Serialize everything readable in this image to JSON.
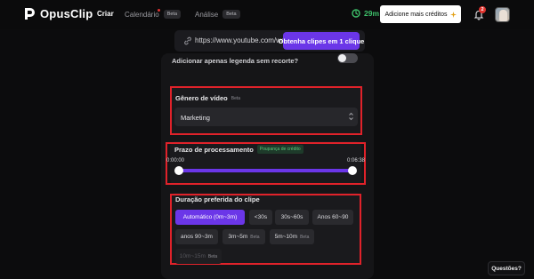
{
  "app": {
    "name": "OpusClip"
  },
  "nav": {
    "criar": "Criar",
    "calendario": "Calendário",
    "calendario_beta": "Beta",
    "analise": "Análise",
    "analise_beta": "Beta"
  },
  "header": {
    "credits": "29m",
    "add_credits": "Adicione mais créditos",
    "notifications_count": "2"
  },
  "url_input": {
    "value": "https://www.youtube.com/wat",
    "button": "Obtenha clipes em 1 clique"
  },
  "subtitle_option": {
    "label": "Adicionar apenas legenda sem recorte?",
    "enabled": false
  },
  "genre": {
    "title": "Gênero de vídeo",
    "beta": "Beta",
    "selected": "Marketing"
  },
  "timeframe": {
    "title": "Prazo de processamento",
    "tag": "Poupança de crédito",
    "start": "0:00:00",
    "end": "0:06:38",
    "range_fraction": [
      0,
      1
    ]
  },
  "duration": {
    "title": "Duração preferida do clipe",
    "options": [
      {
        "label": "Automático (0m~3m)",
        "beta": "",
        "state": "active"
      },
      {
        "label": "<30s",
        "beta": "",
        "state": "normal"
      },
      {
        "label": "30s~60s",
        "beta": "",
        "state": "normal"
      },
      {
        "label": "Anos 60~90",
        "beta": "",
        "state": "normal"
      },
      {
        "label": "anos 90~3m",
        "beta": "",
        "state": "normal"
      },
      {
        "label": "3m~5m",
        "beta": "Beta",
        "state": "normal"
      },
      {
        "label": "5m~10m",
        "beta": "Beta",
        "state": "normal"
      },
      {
        "label": "10m~15m",
        "beta": "Beta",
        "state": "disabled"
      }
    ]
  },
  "help": {
    "label": "Questões?"
  },
  "colors": {
    "accent": "#6b36e8",
    "credits_green": "#3ec26b",
    "highlight_red": "#e0222a",
    "background": "#0c0c0d"
  }
}
